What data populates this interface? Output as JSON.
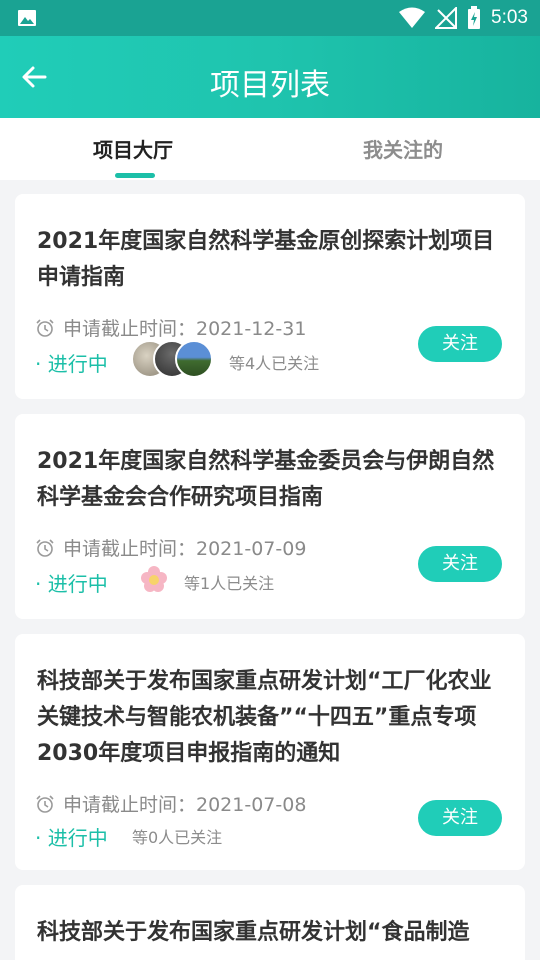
{
  "status_bar": {
    "time": "5:03"
  },
  "header": {
    "title": "项目列表"
  },
  "tabs": [
    {
      "label": "项目大厅"
    },
    {
      "label": "我关注的"
    }
  ],
  "projects": [
    {
      "title": "2021年度国家自然科学基金原创探索计划项目申请指南",
      "deadline": "申请截止时间：2021-12-31",
      "status": "· 进行中",
      "followers": "等4人已关注",
      "follow_label": "关注"
    },
    {
      "title": "2021年度国家自然科学基金委员会与伊朗自然科学基金会合作研究项目指南",
      "deadline": "申请截止时间：2021-07-09",
      "status": "· 进行中",
      "followers": "等1人已关注",
      "follow_label": "关注"
    },
    {
      "title": "科技部关于发布国家重点研发计划“工厂化农业关键技术与智能农机装备”“十四五”重点专项2030年度项目申报指南的通知",
      "deadline": "申请截止时间：2021-07-08",
      "status": "· 进行中",
      "followers": "等0人已关注",
      "follow_label": "关注"
    },
    {
      "title": "科技部关于发布国家重点研发计划“食品制造"
    }
  ]
}
